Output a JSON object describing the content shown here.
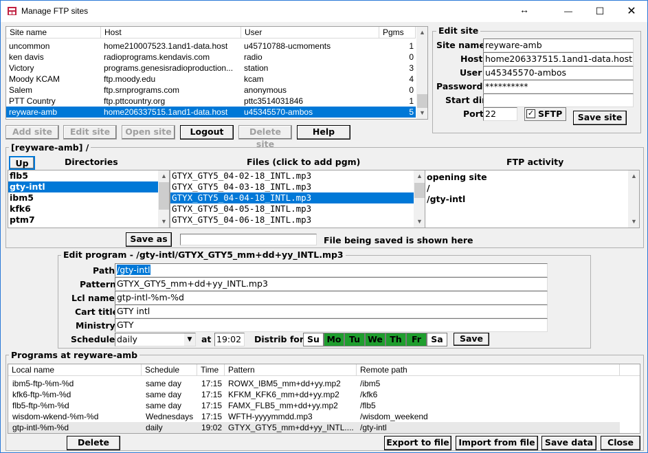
{
  "window": {
    "title": "Manage FTP sites",
    "resize_glyph": "↔",
    "minimize_glyph": "—",
    "maximize_glyph": "☐",
    "close_glyph": "✕"
  },
  "sites": {
    "columns": [
      "Site name",
      "Host",
      "User",
      "Pgms"
    ],
    "rows": [
      {
        "name": "uncommon",
        "host": "home210007523.1and1-data.host",
        "user": "u45710788-ucmoments",
        "pgms": "1"
      },
      {
        "name": "ken davis",
        "host": "radioprograms.kendavis.com",
        "user": "radio",
        "pgms": "0"
      },
      {
        "name": "Victory",
        "host": "programs.genesisradioproduction...",
        "user": "station",
        "pgms": "3"
      },
      {
        "name": "Moody KCAM",
        "host": "ftp.moody.edu",
        "user": "kcam",
        "pgms": "4"
      },
      {
        "name": "Salem",
        "host": "ftp.srnprograms.com",
        "user": "anonymous",
        "pgms": "0"
      },
      {
        "name": "PTT Country",
        "host": "ftp.pttcountry.org",
        "user": "pttc3514031846",
        "pgms": "1"
      },
      {
        "name": "reyware-amb",
        "host": "home206337515.1and1-data.host",
        "user": "u45345570-ambos",
        "pgms": "5"
      }
    ]
  },
  "site_buttons": {
    "add": "Add site",
    "edit": "Edit site",
    "open": "Open site",
    "logout": "Logout",
    "delete": "Delete site",
    "help": "Help"
  },
  "edit_site": {
    "title": "Edit site",
    "labels": {
      "name": "Site name",
      "host": "Host",
      "user": "User",
      "password": "Password",
      "start_dir": "Start dir",
      "port": "Port",
      "sftp": "SFTP"
    },
    "name": "reyware-amb",
    "host": "home206337515.1and1-data.host",
    "user": "u45345570-ambos",
    "password": "**********",
    "start_dir": "",
    "port": "22",
    "sftp_checked": "✓",
    "save": "Save site"
  },
  "browser": {
    "title": "[reyware-amb] /",
    "up": "Up",
    "dirs_header": "Directories",
    "files_header": "Files (click to add pgm)",
    "activity_header": "FTP activity",
    "dirs": [
      "flb5",
      "gty-intl",
      "ibm5",
      "kfk6",
      "ptm7"
    ],
    "files": [
      "GTYX_GTY5_04-02-18_INTL.mp3",
      "GTYX_GTY5_04-03-18_INTL.mp3",
      "GTYX_GTY5_04-04-18_INTL.mp3",
      "GTYX_GTY5_04-05-18_INTL.mp3",
      "GTYX_GTY5_04-06-18_INTL.mp3"
    ],
    "activity": [
      "opening site",
      "/",
      "/gty-intl"
    ],
    "save_as": "Save as",
    "save_as_value": "",
    "save_status": "File being saved is shown here"
  },
  "edit_program": {
    "title": "Edit program - /gty-intl/GTYX_GTY5_mm+dd+yy_INTL.mp3",
    "labels": {
      "path": "Path",
      "pattern": "Pattern",
      "local": "Lcl name",
      "cart": "Cart title",
      "ministry": "Ministry",
      "schedule": "Schedule",
      "at": "at",
      "distrib": "Distrib for:"
    },
    "path": "/gty-intl",
    "pattern": "GTYX_GTY5_mm+dd+yy_INTL.mp3",
    "local": "gtp-intl-%m-%d",
    "cart": "GTY intl",
    "ministry": "GTY",
    "schedule": "daily",
    "time": "19:02",
    "days": [
      "Su",
      "Mo",
      "Tu",
      "We",
      "Th",
      "Fr",
      "Sa"
    ],
    "days_on": [
      false,
      true,
      true,
      true,
      true,
      true,
      false
    ],
    "on_color": "#1f9e2e",
    "save": "Save"
  },
  "programs": {
    "title": "Programs at reyware-amb",
    "columns": [
      "Local name",
      "Schedule",
      "Time",
      "Pattern",
      "Remote path"
    ],
    "rows": [
      {
        "local": "ibm5-ftp-%m-%d",
        "schedule": "same day",
        "time": "17:15",
        "pattern": "ROWX_IBM5_mm+dd+yy.mp2",
        "remote": "/ibm5"
      },
      {
        "local": "kfk6-ftp-%m-%d",
        "schedule": "same day",
        "time": "17:15",
        "pattern": "KFKM_KFK6_mm+dd+yy.mp2",
        "remote": "/kfk6"
      },
      {
        "local": "flb5-ftp-%m-%d",
        "schedule": "same day",
        "time": "17:15",
        "pattern": "FAMX_FLB5_mm+dd+yy.mp2",
        "remote": "/flb5"
      },
      {
        "local": "wisdom-wkend-%m-%d",
        "schedule": "Wednesdays",
        "time": "17:15",
        "pattern": "WFTH-yyyymmdd.mp3",
        "remote": "/wisdom_weekend"
      },
      {
        "local": "gtp-intl-%m-%d",
        "schedule": "daily",
        "time": "19:02",
        "pattern": "GTYX_GTY5_mm+dd+yy_INTL....",
        "remote": "/gty-intl"
      }
    ]
  },
  "bottom_buttons": {
    "delete": "Delete pgm",
    "export": "Export to file",
    "import": "Import from file",
    "save": "Save data",
    "close": "Close"
  },
  "colors": {
    "selection": "#0078d7",
    "window_bg": "#f0f0f0",
    "accent_border": "#2b79d7"
  }
}
